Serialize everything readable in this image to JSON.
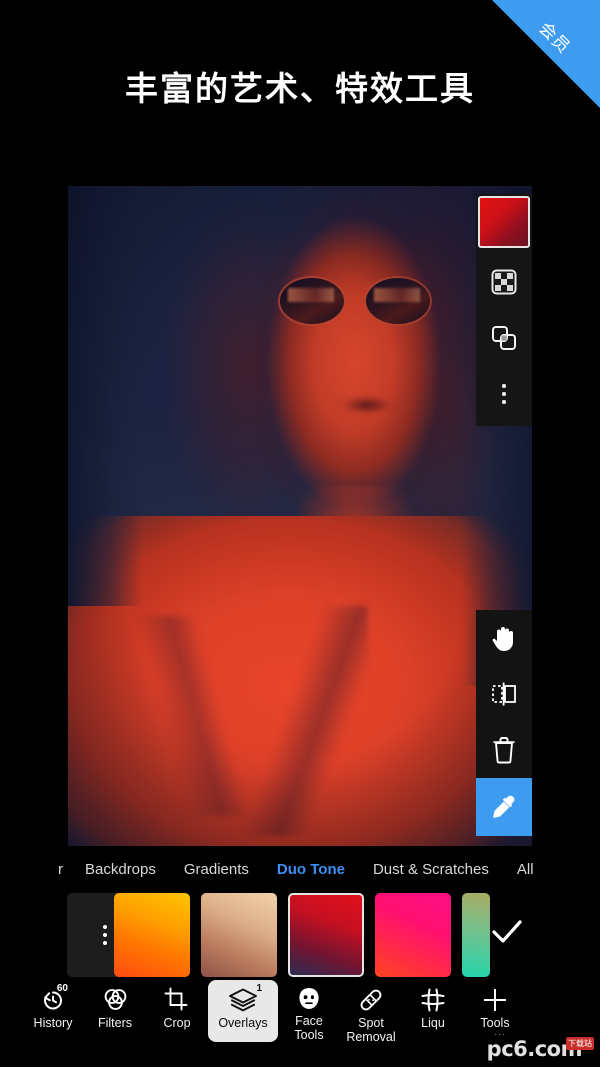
{
  "promo": {
    "title": "丰富的艺术、特效工具",
    "ribbon_label": "会员",
    "ribbon_color": "#3d9bf0",
    "background_color": "#000000"
  },
  "canvas": {
    "photo_alt": "duotone-portrait-woman-sunglasses",
    "duotone": {
      "shadow_color": "#1b2340",
      "highlight_color": "#e8452a"
    }
  },
  "layer_toolbar": {
    "items": [
      {
        "name": "overlay-color-swatch",
        "icon": "red-gradient-swatch",
        "selected": true
      },
      {
        "name": "transparency-toggle",
        "icon": "checkerboard-icon",
        "selected": false
      },
      {
        "name": "blend-mode",
        "icon": "overlapping-squares-icon",
        "selected": false
      },
      {
        "name": "more-options",
        "icon": "vertical-dots-icon",
        "selected": false
      }
    ]
  },
  "edit_toolbar": {
    "items": [
      {
        "name": "pan-tool",
        "icon": "hand-icon",
        "selected": false
      },
      {
        "name": "flip-tool",
        "icon": "flip-horizontal-icon",
        "selected": false
      },
      {
        "name": "delete-layer",
        "icon": "trash-icon",
        "selected": false
      },
      {
        "name": "color-picker",
        "icon": "eyedropper-icon",
        "selected": true,
        "accent_color": "#3d9bf0"
      }
    ]
  },
  "category_tabs": {
    "active": "Duo Tone",
    "active_color": "#3d8ef5",
    "items": [
      {
        "label": "r",
        "clipped": true
      },
      {
        "label": "Backdrops"
      },
      {
        "label": "Gradients"
      },
      {
        "label": "Duo Tone"
      },
      {
        "label": "Dust & Scratches"
      },
      {
        "label": "All"
      }
    ]
  },
  "swatches": {
    "confirm_label": "✓",
    "items": [
      {
        "name": "more-presets",
        "type": "menu",
        "icon": "vertical-dots-icon"
      },
      {
        "name": "swatch-orange",
        "type": "gradient",
        "colors": [
          "#ffb300",
          "#ff5a00"
        ]
      },
      {
        "name": "swatch-tan",
        "type": "gradient",
        "colors": [
          "#f0cfa8",
          "#9a5a45"
        ]
      },
      {
        "name": "swatch-crimson",
        "type": "gradient",
        "colors": [
          "#e01020",
          "#2b2a52"
        ],
        "selected": true
      },
      {
        "name": "swatch-magenta",
        "type": "gradient",
        "colors": [
          "#ff1170",
          "#ff3a2a"
        ]
      },
      {
        "name": "swatch-teal",
        "type": "gradient",
        "colors": [
          "#a9ab62",
          "#22d6ae"
        ],
        "clipped": true
      }
    ]
  },
  "bottom_nav": {
    "active": "Overlays",
    "items": [
      {
        "label": "History",
        "icon": "undo-clock-icon",
        "badge": "60"
      },
      {
        "label": "Filters",
        "icon": "three-circles-icon"
      },
      {
        "label": "Crop",
        "icon": "crop-icon"
      },
      {
        "label": "Overlays",
        "icon": "layers-icon",
        "badge": "1",
        "active": true
      },
      {
        "label": "Face\nTools",
        "icon": "face-icon"
      },
      {
        "label": "Spot\nRemoval",
        "icon": "bandage-icon"
      },
      {
        "label": "Liqu",
        "icon": "liquify-grid-icon"
      },
      {
        "label": "Tools",
        "icon": "plus-icon"
      }
    ]
  },
  "watermark": {
    "text": "pc6",
    "suffix": ".com",
    "badge": "下载站"
  }
}
